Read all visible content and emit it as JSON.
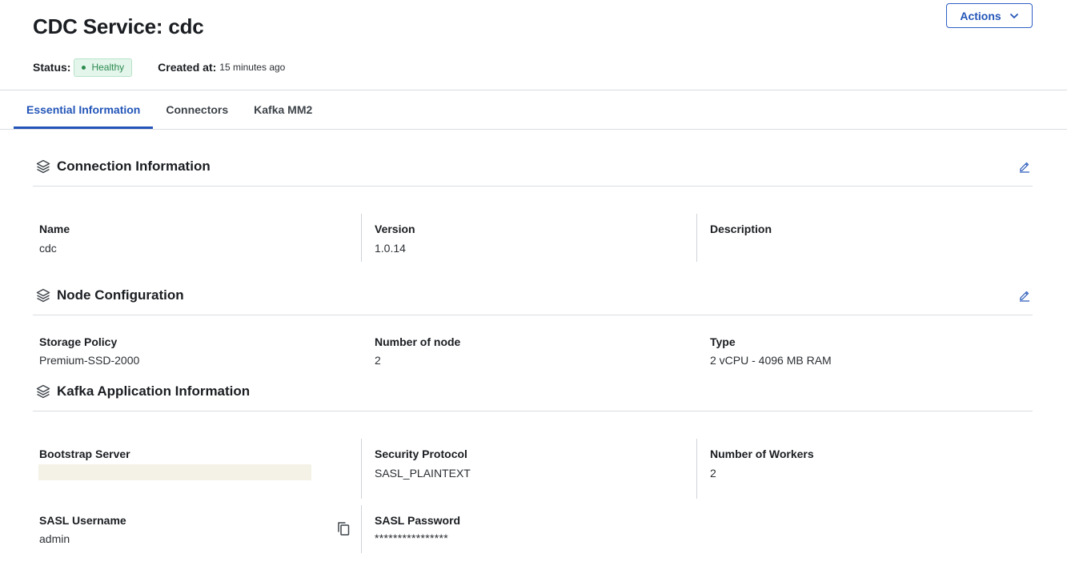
{
  "header": {
    "title": "CDC Service: cdc",
    "actions_label": "Actions",
    "status_label": "Status:",
    "status_value": "Healthy",
    "created_label": "Created at:",
    "created_value": "15 minutes ago"
  },
  "tabs": [
    {
      "label": "Essential Information",
      "active": true
    },
    {
      "label": "Connectors",
      "active": false
    },
    {
      "label": "Kafka MM2",
      "active": false
    }
  ],
  "connection": {
    "title": "Connection Information",
    "fields": [
      {
        "label": "Name",
        "value": "cdc"
      },
      {
        "label": "Version",
        "value": "1.0.14"
      },
      {
        "label": "Description",
        "value": ""
      }
    ]
  },
  "node": {
    "title": "Node Configuration",
    "fields": [
      {
        "label": "Storage Policy",
        "value": "Premium-SSD-2000"
      },
      {
        "label": "Number of node",
        "value": "2"
      },
      {
        "label": "Type",
        "value": "2 vCPU - 4096 MB RAM"
      }
    ]
  },
  "kafka": {
    "title": "Kafka Application Information",
    "fields": [
      {
        "label": "Bootstrap Server",
        "value": ""
      },
      {
        "label": "Security Protocol",
        "value": "SASL_PLAINTEXT"
      },
      {
        "label": "Number of Workers",
        "value": "2"
      },
      {
        "label": "SASL Username",
        "value": "admin"
      },
      {
        "label": "SASL Password",
        "value": "****************"
      }
    ]
  },
  "icons": {
    "section": "layers-icon",
    "edit": "pencil-icon",
    "copy": "copy-icon",
    "dropdown": "chevron-down-icon"
  },
  "colors": {
    "accent": "#2355b8",
    "healthy_bg": "#e4f6ec",
    "healthy_text": "#2b8a4e"
  }
}
